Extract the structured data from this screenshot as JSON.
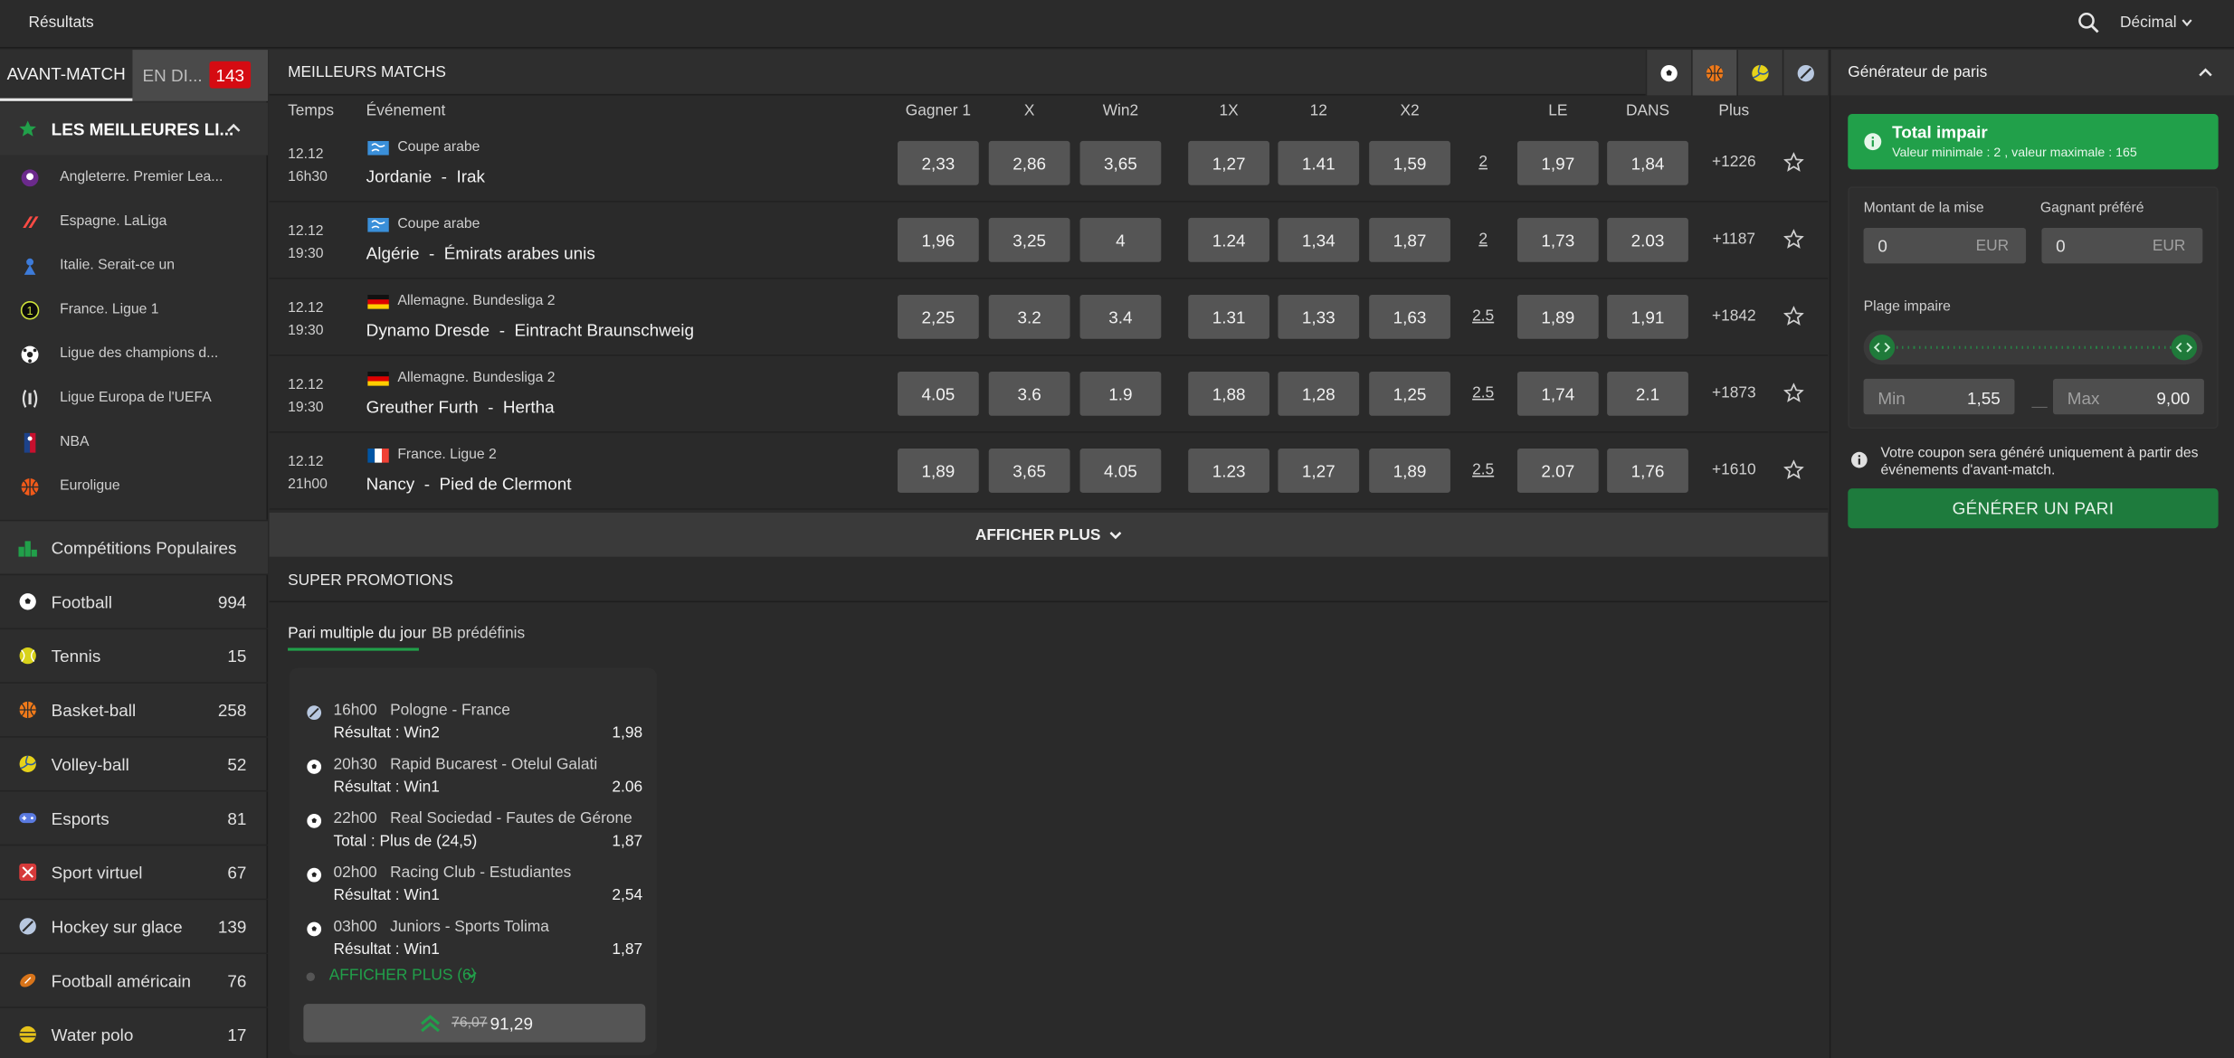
{
  "topbar": {
    "results": "Résultats",
    "odds_format": "Décimal"
  },
  "sidebar": {
    "tab_prematch": "AVANT-MATCH",
    "tab_live": "EN DI...",
    "live_count": "143",
    "top_leagues_title": "LES MEILLEURES LI...",
    "leagues": [
      {
        "label": "Angleterre. Premier Lea...",
        "icon": "premier-league-icon"
      },
      {
        "label": "Espagne. LaLiga",
        "icon": "laliga-icon"
      },
      {
        "label": "Italie. Serait-ce un",
        "icon": "serie-a-icon"
      },
      {
        "label": "France. Ligue 1",
        "icon": "ligue1-icon"
      },
      {
        "label": "Ligue des champions d...",
        "icon": "champions-league-icon"
      },
      {
        "label": "Ligue Europa de l'UEFA",
        "icon": "europa-league-icon"
      },
      {
        "label": "NBA",
        "icon": "nba-icon"
      },
      {
        "label": "Euroligue",
        "icon": "euroleague-icon"
      }
    ],
    "popular": "Compétitions Populaires",
    "sports": [
      {
        "label": "Football",
        "count": "994",
        "icon": "football-icon"
      },
      {
        "label": "Tennis",
        "count": "15",
        "icon": "tennis-icon"
      },
      {
        "label": "Basket-ball",
        "count": "258",
        "icon": "basketball-icon"
      },
      {
        "label": "Volley-ball",
        "count": "52",
        "icon": "volleyball-icon"
      },
      {
        "label": "Esports",
        "count": "81",
        "icon": "gamepad-icon"
      },
      {
        "label": "Sport virtuel",
        "count": "67",
        "icon": "virtual-sport-icon"
      },
      {
        "label": "Hockey sur glace",
        "count": "139",
        "icon": "ice-hockey-icon"
      },
      {
        "label": "Football américain",
        "count": "76",
        "icon": "american-football-icon"
      },
      {
        "label": "Water polo",
        "count": "17",
        "icon": "water-polo-icon"
      }
    ]
  },
  "main": {
    "title": "MEILLEURS MATCHS",
    "columns": {
      "time": "Temps",
      "event": "Événement",
      "w1": "Gagner 1",
      "x": "X",
      "w2": "Win2",
      "dc1x": "1X",
      "dc12": "12",
      "dcx2": "X2",
      "over": "LE",
      "under": "DANS",
      "more": "Plus"
    },
    "matches": [
      {
        "date": "12.12",
        "time": "16h30",
        "competition": "Coupe arabe",
        "flag": "world",
        "home": "Jordanie",
        "away": "Irak",
        "odds": [
          "2,33",
          "2,86",
          "3,65",
          "1,27",
          "1.41",
          "1,59"
        ],
        "total": "2",
        "over": "1,97",
        "under": "1,84",
        "more": "+1226"
      },
      {
        "date": "12.12",
        "time": "19:30",
        "competition": "Coupe arabe",
        "flag": "world",
        "home": "Algérie",
        "away": "Émirats arabes unis",
        "odds": [
          "1,96",
          "3,25",
          "4",
          "1.24",
          "1,34",
          "1,87"
        ],
        "total": "2",
        "over": "1,73",
        "under": "2.03",
        "more": "+1187"
      },
      {
        "date": "12.12",
        "time": "19:30",
        "competition": "Allemagne. Bundesliga 2",
        "flag": "germany",
        "home": "Dynamo Dresde",
        "away": "Eintracht Braunschweig",
        "odds": [
          "2,25",
          "3.2",
          "3.4",
          "1.31",
          "1,33",
          "1,63"
        ],
        "total": "2.5",
        "over": "1,89",
        "under": "1,91",
        "more": "+1842"
      },
      {
        "date": "12.12",
        "time": "19:30",
        "competition": "Allemagne. Bundesliga 2",
        "flag": "germany",
        "home": "Greuther Furth",
        "away": "Hertha",
        "odds": [
          "4.05",
          "3.6",
          "1.9",
          "1,88",
          "1,28",
          "1,25"
        ],
        "total": "2.5",
        "over": "1,74",
        "under": "2.1",
        "more": "+1873"
      },
      {
        "date": "12.12",
        "time": "21h00",
        "competition": "France. Ligue 2",
        "flag": "france",
        "home": "Nancy",
        "away": "Pied de Clermont",
        "odds": [
          "1,89",
          "3,65",
          "4.05",
          "1.23",
          "1,27",
          "1,89"
        ],
        "total": "2.5",
        "over": "2.07",
        "under": "1,76",
        "more": "+1610"
      }
    ],
    "show_more": "AFFICHER PLUS",
    "super_promotions": "SUPER PROMOTIONS",
    "promo_tabs": [
      "Pari multiple du jour",
      "BB prédéfinis"
    ],
    "accumulator": {
      "items": [
        {
          "time": "16h00",
          "match": "Pologne - France",
          "result": "Résultat : Win2",
          "odd": "1,98",
          "icon": "handball-icon"
        },
        {
          "time": "20h30",
          "match": "Rapid Bucarest - Otelul Galati",
          "result": "Résultat : Win1",
          "odd": "2.06",
          "icon": "football-icon"
        },
        {
          "time": "22h00",
          "match": "Real Sociedad - Fautes de Gérone",
          "result": "Total : Plus de (24,5)",
          "odd": "1,87",
          "icon": "football-icon"
        },
        {
          "time": "02h00",
          "match": "Racing Club - Estudiantes",
          "result": "Résultat : Win1",
          "odd": "2,54",
          "icon": "football-icon"
        },
        {
          "time": "03h00",
          "match": "Juniors - Sports Tolima",
          "result": "Résultat : Win1",
          "odd": "1,87",
          "icon": "football-icon"
        }
      ],
      "show_more": "AFFICHER PLUS (6)",
      "old_total": "76,07",
      "new_total": "91,29"
    }
  },
  "generator": {
    "title": "Générateur de paris",
    "option_title": "Total impair",
    "option_sub": "Valeur minimale : 2 , valeur maximale : 165",
    "stake_label": "Montant de la mise",
    "stake_value": "0",
    "win_label": "Gagnant préféré",
    "win_value": "0",
    "currency": "EUR",
    "range_label": "Plage impaire",
    "min_label": "Min",
    "min_value": "1,55",
    "max_label": "Max",
    "max_value": "9,00",
    "dash": "—",
    "note": "Votre coupon sera généré uniquement à partir des événements d'avant-match.",
    "button": "GÉNÉRER UN PARI"
  },
  "colors": {
    "accent": "#21a04a",
    "live_badge": "#d50b12",
    "odd_button": "#555555",
    "background": "#2a2a2a"
  }
}
